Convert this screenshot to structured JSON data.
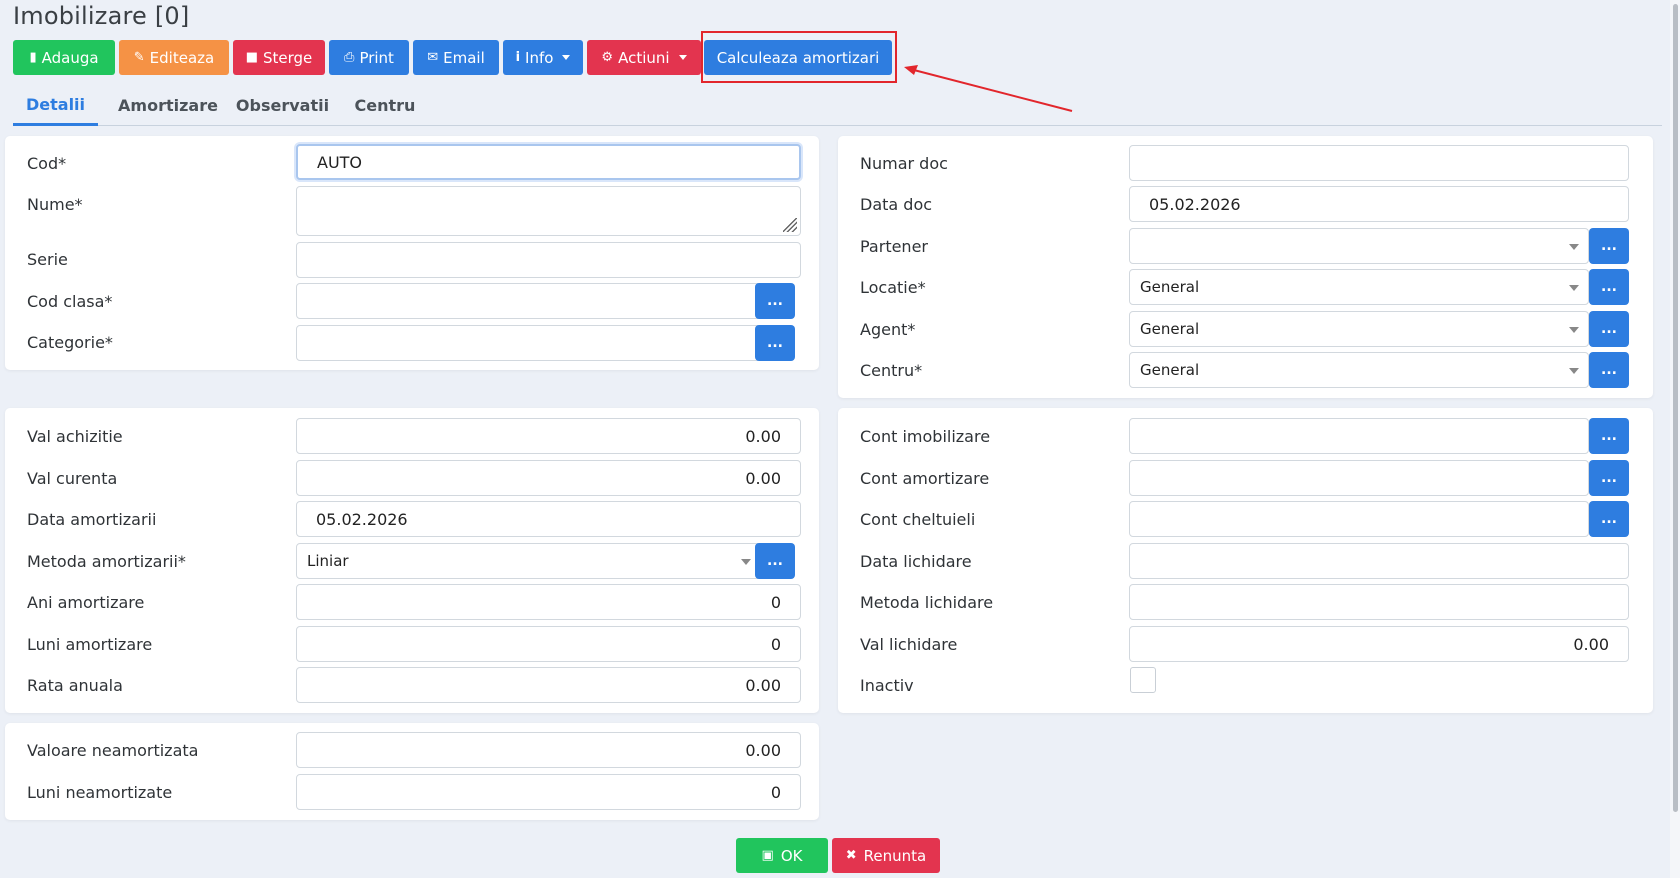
{
  "page": {
    "title": "Imobilizare [0]"
  },
  "toolbar": {
    "add": "Adauga",
    "edit": "Editeaza",
    "delete": "Sterge",
    "print": "Print",
    "email": "Email",
    "info": "Info",
    "actions": "Actiuni",
    "calculate": "Calculeaza amortizari"
  },
  "tabs": [
    "Detalii",
    "Amortizare",
    "Observatii",
    "Centru"
  ],
  "left_top": {
    "cod_label": "Cod*",
    "cod_value": "AUTO",
    "nume_label": "Nume*",
    "nume_value": "",
    "serie_label": "Serie",
    "serie_value": "",
    "cod_clasa_label": "Cod clasa*",
    "cod_clasa_value": "",
    "categorie_label": "Categorie*",
    "categorie_value": "",
    "browse": "..."
  },
  "right_top": {
    "numar_doc_label": "Numar doc",
    "numar_doc_value": "",
    "data_doc_label": "Data doc",
    "data_doc_value": "05.02.2026",
    "partener_label": "Partener",
    "partener_value": "",
    "locatie_label": "Locatie*",
    "locatie_value": "General",
    "agent_label": "Agent*",
    "agent_value": "General",
    "centru_label": "Centru*",
    "centru_value": "General"
  },
  "left_mid": {
    "val_achizitie_label": "Val achizitie",
    "val_achizitie_value": "0.00",
    "val_curenta_label": "Val curenta",
    "val_curenta_value": "0.00",
    "data_amortizarii_label": "Data amortizarii",
    "data_amortizarii_value": "05.02.2026",
    "metoda_label": "Metoda amortizarii*",
    "metoda_value": "Liniar",
    "ani_label": "Ani amortizare",
    "ani_value": "0",
    "luni_label": "Luni amortizare",
    "luni_value": "0",
    "rata_label": "Rata anuala",
    "rata_value": "0.00"
  },
  "right_mid": {
    "cont_imobilizare_label": "Cont imobilizare",
    "cont_imobilizare_value": "",
    "cont_amortizare_label": "Cont amortizare",
    "cont_amortizare_value": "",
    "cont_cheltuieli_label": "Cont cheltuieli",
    "cont_cheltuieli_value": "",
    "data_lichidare_label": "Data lichidare",
    "data_lichidare_value": "",
    "metoda_lichidare_label": "Metoda lichidare",
    "metoda_lichidare_value": "",
    "val_lichidare_label": "Val lichidare",
    "val_lichidare_value": "0.00",
    "inactiv_label": "Inactiv"
  },
  "left_bottom": {
    "valoare_neamortizata_label": "Valoare neamortizata",
    "valoare_neamortizata_value": "0.00",
    "luni_neamortizate_label": "Luni neamortizate",
    "luni_neamortizate_value": "0"
  },
  "footer": {
    "ok": "OK",
    "cancel": "Renunta"
  },
  "colors": {
    "green": "#21c55d",
    "orange": "#f59245",
    "red": "#e3344f",
    "blue": "#2e7de0",
    "annotation": "#e2262c"
  }
}
